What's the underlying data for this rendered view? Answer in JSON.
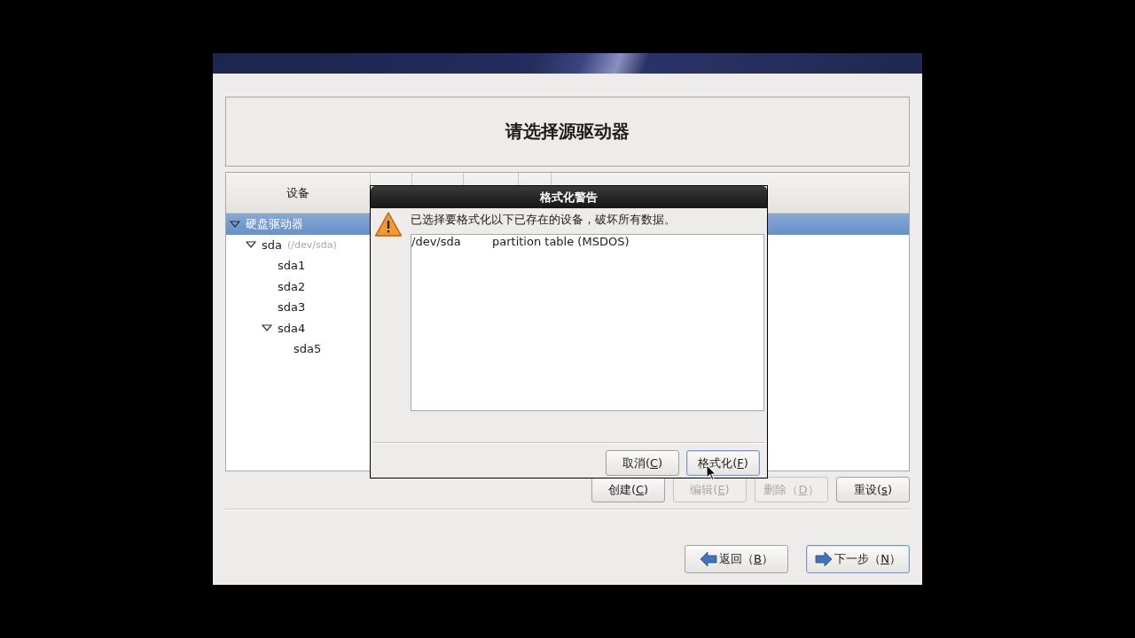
{
  "title": "请选择源驱动器",
  "table": {
    "columns": [
      "设备"
    ],
    "tree": [
      {
        "label": "硬盘驱动器",
        "selected": true,
        "expanded": true,
        "children": [
          {
            "label": "sda",
            "detail": "(/dev/sda)",
            "selected": false,
            "expanded": true,
            "children": [
              {
                "label": "sda1",
                "selected": false
              },
              {
                "label": "sda2",
                "selected": false
              },
              {
                "label": "sda3",
                "selected": false
              },
              {
                "label": "sda4",
                "selected": false,
                "expanded": true,
                "children": [
                  {
                    "label": "sda5",
                    "selected": false
                  }
                ]
              }
            ]
          }
        ]
      }
    ]
  },
  "table_buttons": [
    {
      "before": "创建(",
      "key": "C",
      "after": ")",
      "disabled": false
    },
    {
      "before": "编辑(",
      "key": "E",
      "after": ")",
      "disabled": true
    },
    {
      "before": "删除（",
      "key": "D",
      "after": "）",
      "disabled": true
    },
    {
      "before": "重设(",
      "key": "s",
      "after": ")",
      "disabled": false
    }
  ],
  "nav_buttons": [
    {
      "kind": "back",
      "before": "返回（",
      "key": "B",
      "after": "）",
      "focused": false
    },
    {
      "kind": "next",
      "before": "下一步（",
      "key": "N",
      "after": "）",
      "focused": true
    }
  ],
  "dialog": {
    "title": "格式化警告",
    "message": "已选择要格式化以下已存在的设备，破坏所有数据。",
    "items": [
      {
        "device": "/dev/sda",
        "description": "partition table (MSDOS)"
      }
    ],
    "buttons": [
      {
        "before": "取消(",
        "key": "C",
        "after": ")",
        "focused": false
      },
      {
        "before": "格式化(",
        "key": "F",
        "after": ")",
        "focused": true
      }
    ]
  }
}
